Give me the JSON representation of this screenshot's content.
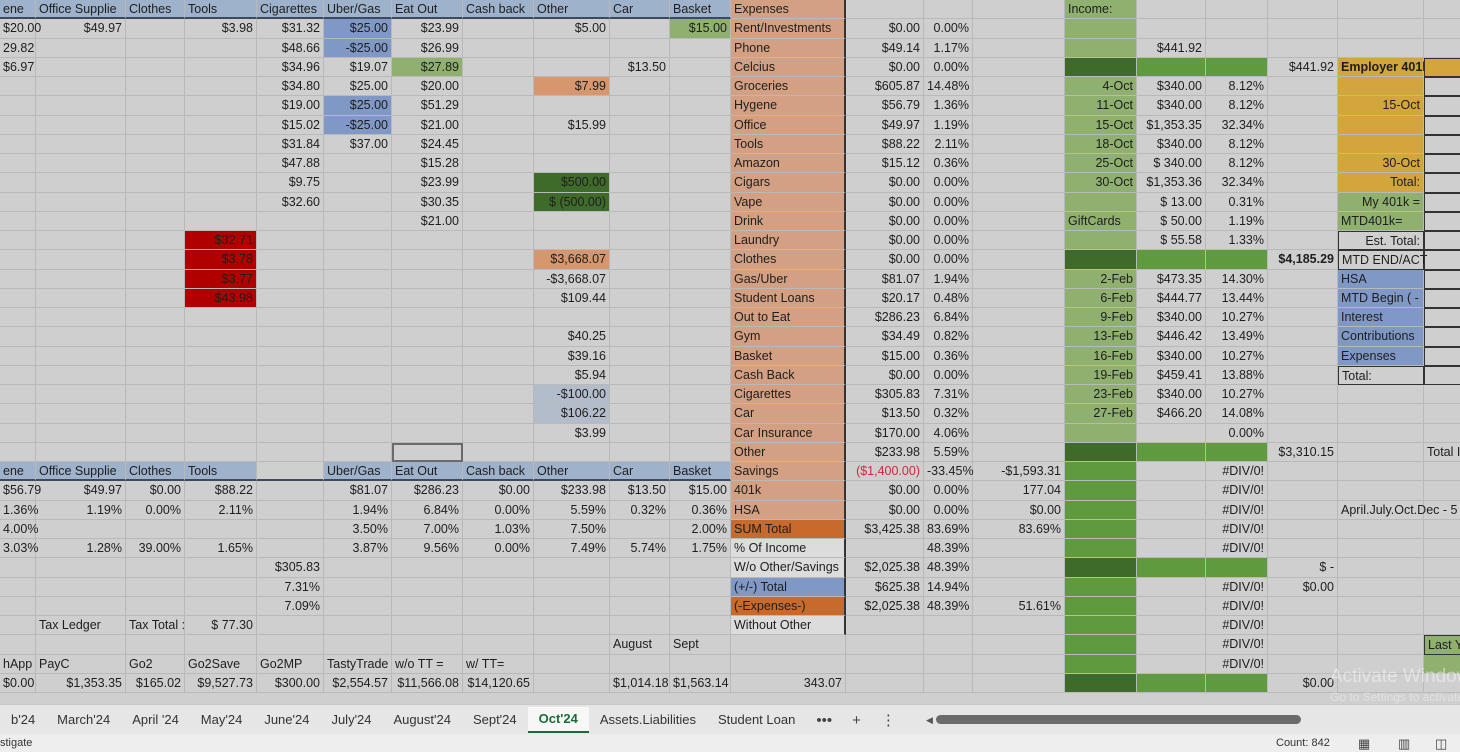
{
  "sheet": {
    "rows": [
      [
        "ene",
        "Office Supplie",
        "Clothes",
        "Tools",
        "Cigarettes",
        "Uber/Gas",
        "Eat Out",
        "Cash back",
        "Other",
        "Car",
        "Basket",
        "Expenses",
        "",
        "",
        "",
        "Income:",
        "",
        "",
        "",
        "",
        ""
      ],
      [
        "$20.00",
        "$49.97",
        "",
        "$3.98",
        "$31.32",
        "$25.00",
        "$23.99",
        "",
        "$5.00",
        "",
        "$15.00",
        "Rent/Investments",
        "$0.00",
        "0.00%",
        "",
        "",
        "",
        "",
        "",
        "",
        ""
      ],
      [
        "29.82",
        "",
        "",
        "",
        "$48.66",
        "-$25.00",
        "$26.99",
        "",
        "",
        "",
        "",
        "Phone",
        "$49.14",
        "1.17%",
        "",
        "",
        "$441.92",
        "",
        "",
        "",
        ""
      ],
      [
        "$6.97",
        "",
        "",
        "",
        "$34.96",
        "$19.07",
        "$27.89",
        "",
        "",
        "$13.50",
        "",
        "Celcius",
        "$0.00",
        "0.00%",
        "",
        "",
        "",
        "",
        "$441.92",
        "Employer 401k Contr",
        ""
      ],
      [
        "",
        "",
        "",
        "",
        "$34.80",
        "$25.00",
        "$20.00",
        "",
        "$7.99",
        "",
        "",
        "Groceries",
        "$605.87",
        "14.48%",
        "",
        "4-Oct",
        "$340.00",
        "8.12%",
        "",
        "",
        ""
      ],
      [
        "",
        "",
        "",
        "",
        "$19.00",
        "$25.00",
        "$51.29",
        "",
        "",
        "",
        "",
        "Hygene",
        "$56.79",
        "1.36%",
        "",
        "11-Oct",
        "$340.00",
        "8.12%",
        "",
        "15-Oct",
        "$1"
      ],
      [
        "",
        "",
        "",
        "",
        "$15.02",
        "-$25.00",
        "$21.00",
        "",
        "$15.99",
        "",
        "",
        "Office",
        "$49.97",
        "1.19%",
        "",
        "15-Oct",
        "$1,353.35",
        "32.34%",
        "",
        "",
        ""
      ],
      [
        "",
        "",
        "",
        "",
        "$31.84",
        "$37.00",
        "$24.45",
        "",
        "",
        "",
        "",
        "Tools",
        "$88.22",
        "2.11%",
        "",
        "18-Oct",
        "$340.00",
        "8.12%",
        "",
        "",
        ""
      ],
      [
        "",
        "",
        "",
        "",
        "$47.88",
        "",
        "$15.28",
        "",
        "",
        "",
        "",
        "Amazon",
        "$15.12",
        "0.36%",
        "",
        "25-Oct",
        "$  340.00",
        "8.12%",
        "",
        "30-Oct",
        "$1"
      ],
      [
        "",
        "",
        "",
        "",
        "$9.75",
        "",
        "$23.99",
        "",
        "$500.00",
        "",
        "",
        "Cigars",
        "$0.00",
        "0.00%",
        "",
        "30-Oct",
        "$1,353.36",
        "32.34%",
        "",
        "Total:",
        "$2"
      ],
      [
        "",
        "",
        "",
        "",
        "$32.60",
        "",
        "$30.35",
        "",
        "$  (500.00)",
        "",
        "",
        "Vape",
        "$0.00",
        "0.00%",
        "",
        "",
        "$    13.00",
        "0.31%",
        "",
        "My 401k =",
        "$6"
      ],
      [
        "",
        "",
        "",
        "",
        "",
        "",
        "$21.00",
        "",
        "",
        "",
        "",
        "Drink",
        "$0.00",
        "0.00%",
        "",
        "GiftCards",
        "$    50.00",
        "1.19%",
        "",
        "MTD401k=",
        "$8"
      ],
      [
        "",
        "",
        "",
        "$32.71",
        "",
        "",
        "",
        "",
        "",
        "",
        "",
        "Laundry",
        "$0.00",
        "0.00%",
        "",
        "",
        "$    55.58",
        "1.33%",
        "",
        "Est. Total:",
        "$9,0"
      ],
      [
        "",
        "",
        "",
        "$3.78",
        "",
        "",
        "",
        "",
        "$3,668.07",
        "",
        "",
        "Clothes",
        "$0.00",
        "0.00%",
        "",
        "",
        "",
        "",
        "$4,185.29",
        "MTD END/ACT",
        "81"
      ],
      [
        "",
        "",
        "",
        "$3.77",
        "",
        "",
        "",
        "",
        "-$3,668.07",
        "",
        "",
        "Gas/Uber",
        "$81.07",
        "1.94%",
        "",
        "2-Feb",
        "$473.35",
        "14.30%",
        "",
        "HSA",
        ""
      ],
      [
        "",
        "",
        "",
        "$43.98",
        "",
        "",
        "",
        "",
        "$109.44",
        "",
        "",
        "Student Loans",
        "$20.17",
        "0.48%",
        "",
        "6-Feb",
        "$444.77",
        "13.44%",
        "",
        "MTD Begin ( -",
        "26"
      ],
      [
        "",
        "",
        "",
        "",
        "",
        "",
        "",
        "",
        "",
        "",
        "",
        "Out to Eat",
        "$286.23",
        "6.84%",
        "",
        "9-Feb",
        "$340.00",
        "10.27%",
        "",
        "Interest",
        ""
      ],
      [
        "",
        "",
        "",
        "",
        "",
        "",
        "",
        "",
        "$40.25",
        "",
        "",
        "Gym",
        "$34.49",
        "0.82%",
        "",
        "13-Feb",
        "$446.42",
        "13.49%",
        "",
        "Contributions",
        "$1"
      ],
      [
        "",
        "",
        "",
        "",
        "",
        "",
        "",
        "",
        "$39.16",
        "",
        "",
        "Basket",
        "$15.00",
        "0.36%",
        "",
        "16-Feb",
        "$340.00",
        "10.27%",
        "",
        "Expenses",
        "$"
      ],
      [
        "",
        "",
        "",
        "",
        "",
        "",
        "",
        "",
        "$5.94",
        "",
        "",
        "Cash Back",
        "$0.00",
        "0.00%",
        "",
        "19-Feb",
        "$459.41",
        "13.88%",
        "",
        "Total:",
        "$2,7"
      ],
      [
        "",
        "",
        "",
        "",
        "",
        "",
        "",
        "",
        "-$100.00",
        "",
        "",
        "Cigarettes",
        "$305.83",
        "7.31%",
        "",
        "23-Feb",
        "$340.00",
        "10.27%",
        "",
        "",
        ""
      ],
      [
        "",
        "",
        "",
        "",
        "",
        "",
        "",
        "",
        "$106.22",
        "",
        "",
        "Car",
        "$13.50",
        "0.32%",
        "",
        "27-Feb",
        "$466.20",
        "14.08%",
        "",
        "",
        ""
      ],
      [
        "",
        "",
        "",
        "",
        "",
        "",
        "",
        "",
        "$3.99",
        "",
        "",
        "Car Insurance",
        "$170.00",
        "4.06%",
        "",
        "",
        "",
        "0.00%",
        "",
        "",
        ""
      ],
      [
        "",
        "",
        "",
        "",
        "",
        "",
        "",
        "",
        "",
        "",
        "",
        "Other",
        "$233.98",
        "5.59%",
        "",
        "",
        "",
        "",
        "$3,310.15",
        "",
        "Total I"
      ],
      [
        "ene",
        "Office Supplie",
        "Clothes",
        "Tools",
        "",
        "Uber/Gas",
        "Eat Out",
        "Cash back",
        "Other",
        "Car",
        "Basket",
        "Savings",
        "($1,400.00)",
        "-33.45%",
        "-$1,593.31",
        "",
        "",
        "#DIV/0!",
        "",
        "",
        "$32,5"
      ],
      [
        "$56.79",
        "$49.97",
        "$0.00",
        "$88.22",
        "",
        "$81.07",
        "$286.23",
        "$0.00",
        "$233.98",
        "$13.50",
        "$15.00",
        "401k",
        "$0.00",
        "0.00%",
        "177.04",
        "",
        "",
        "#DIV/0!",
        "",
        "",
        ""
      ],
      [
        "1.36%",
        "1.19%",
        "0.00%",
        "2.11%",
        "",
        "1.94%",
        "6.84%",
        "0.00%",
        "5.59%",
        "0.32%",
        "0.36%",
        "HSA",
        "$0.00",
        "0.00%",
        "$0.00",
        "",
        "",
        "#DIV/0!",
        "",
        "April.July.Oct.Dec - 5",
        ""
      ],
      [
        "4.00%",
        "",
        "",
        "",
        "",
        "3.50%",
        "7.00%",
        "1.03%",
        "7.50%",
        "",
        "2.00%",
        "SUM Total",
        "$3,425.38",
        "83.69%",
        "83.69%",
        "",
        "",
        "#DIV/0!",
        "",
        "",
        ""
      ],
      [
        "3.03%",
        "1.28%",
        "39.00%",
        "1.65%",
        "",
        "3.87%",
        "9.56%",
        "0.00%",
        "7.49%",
        "5.74%",
        "1.75%",
        "% Of Income",
        "",
        "48.39%",
        "",
        "",
        "",
        "#DIV/0!",
        "",
        "",
        ""
      ],
      [
        "",
        "",
        "",
        "",
        "$305.83",
        "",
        "",
        "",
        "",
        "",
        "",
        "W/o Other/Savings",
        "$2,025.38",
        "48.39%",
        "",
        "",
        "",
        "",
        "$     -",
        "",
        ""
      ],
      [
        "",
        "",
        "",
        "",
        "7.31%",
        "",
        "",
        "",
        "",
        "",
        "",
        "(+/-) Total",
        "$625.38",
        "14.94%",
        "",
        "",
        "",
        "#DIV/0!",
        "$0.00",
        "",
        ""
      ],
      [
        "",
        "",
        "",
        "",
        "7.09%",
        "",
        "",
        "",
        "",
        "",
        "",
        "(-Expenses-)",
        "$2,025.38",
        "48.39%",
        "51.61%",
        "",
        "",
        "#DIV/0!",
        "",
        "",
        ""
      ],
      [
        "",
        "Tax Ledger",
        "Tax Total :",
        "$    77.30",
        "",
        "",
        "",
        "",
        "",
        "",
        "",
        "Without Other",
        "",
        "",
        "",
        "",
        "",
        "#DIV/0!",
        "",
        "",
        ""
      ],
      [
        "",
        "",
        "",
        "",
        "",
        "",
        "",
        "",
        "",
        "August",
        "Sept",
        "",
        "",
        "",
        "",
        "",
        "",
        "#DIV/0!",
        "",
        "",
        "Last Y"
      ],
      [
        "hApp",
        "PayC",
        "Go2",
        "Go2Save",
        "Go2MP",
        "TastyTrade",
        "w/o TT =",
        "w/ TT=",
        "",
        "",
        "",
        "",
        "",
        "",
        "",
        "",
        "",
        "#DIV/0!",
        "",
        "",
        ""
      ],
      [
        "$0.00",
        "$1,353.35",
        "$165.02",
        "$9,527.73",
        "$300.00",
        "$2,554.57",
        "$11,566.08",
        "$14,120.65",
        "",
        "$1,014.18",
        "$1,563.14",
        "343.07",
        "",
        "",
        "",
        "",
        "",
        "",
        "$0.00",
        "",
        ""
      ]
    ],
    "selected_cell": "23-6",
    "colors": {
      "header": "#9fb2cc",
      "expense_label": "#d3a083",
      "expense_dark": "#c86a2c",
      "blue": "#7f98c6",
      "blue_gray": "#b3bccb",
      "light_green": "#8fb06f",
      "income_green": "#5f9a3e",
      "dark_green": "#3f6b2a",
      "yellow": "#d2a63c",
      "red": "#b00000",
      "orange_cell": "#d7976e",
      "pale": "#dcdcdc",
      "negative_text": "#d0283c"
    }
  },
  "tabs": [
    "b'24",
    "March'24",
    "April '24",
    "May'24",
    "June'24",
    "July'24",
    "August'24",
    "Sept'24",
    "Oct'24",
    "Assets.Liabilities",
    "Student Loan"
  ],
  "active_tab": "Oct'24",
  "tab_more": "•••",
  "tab_add": "+",
  "tab_options": "⋮",
  "status": {
    "left": "stigate",
    "count": "Count: 842"
  },
  "watermark": {
    "line1": "Activate Windows",
    "line2": "Go to Settings to activate"
  }
}
